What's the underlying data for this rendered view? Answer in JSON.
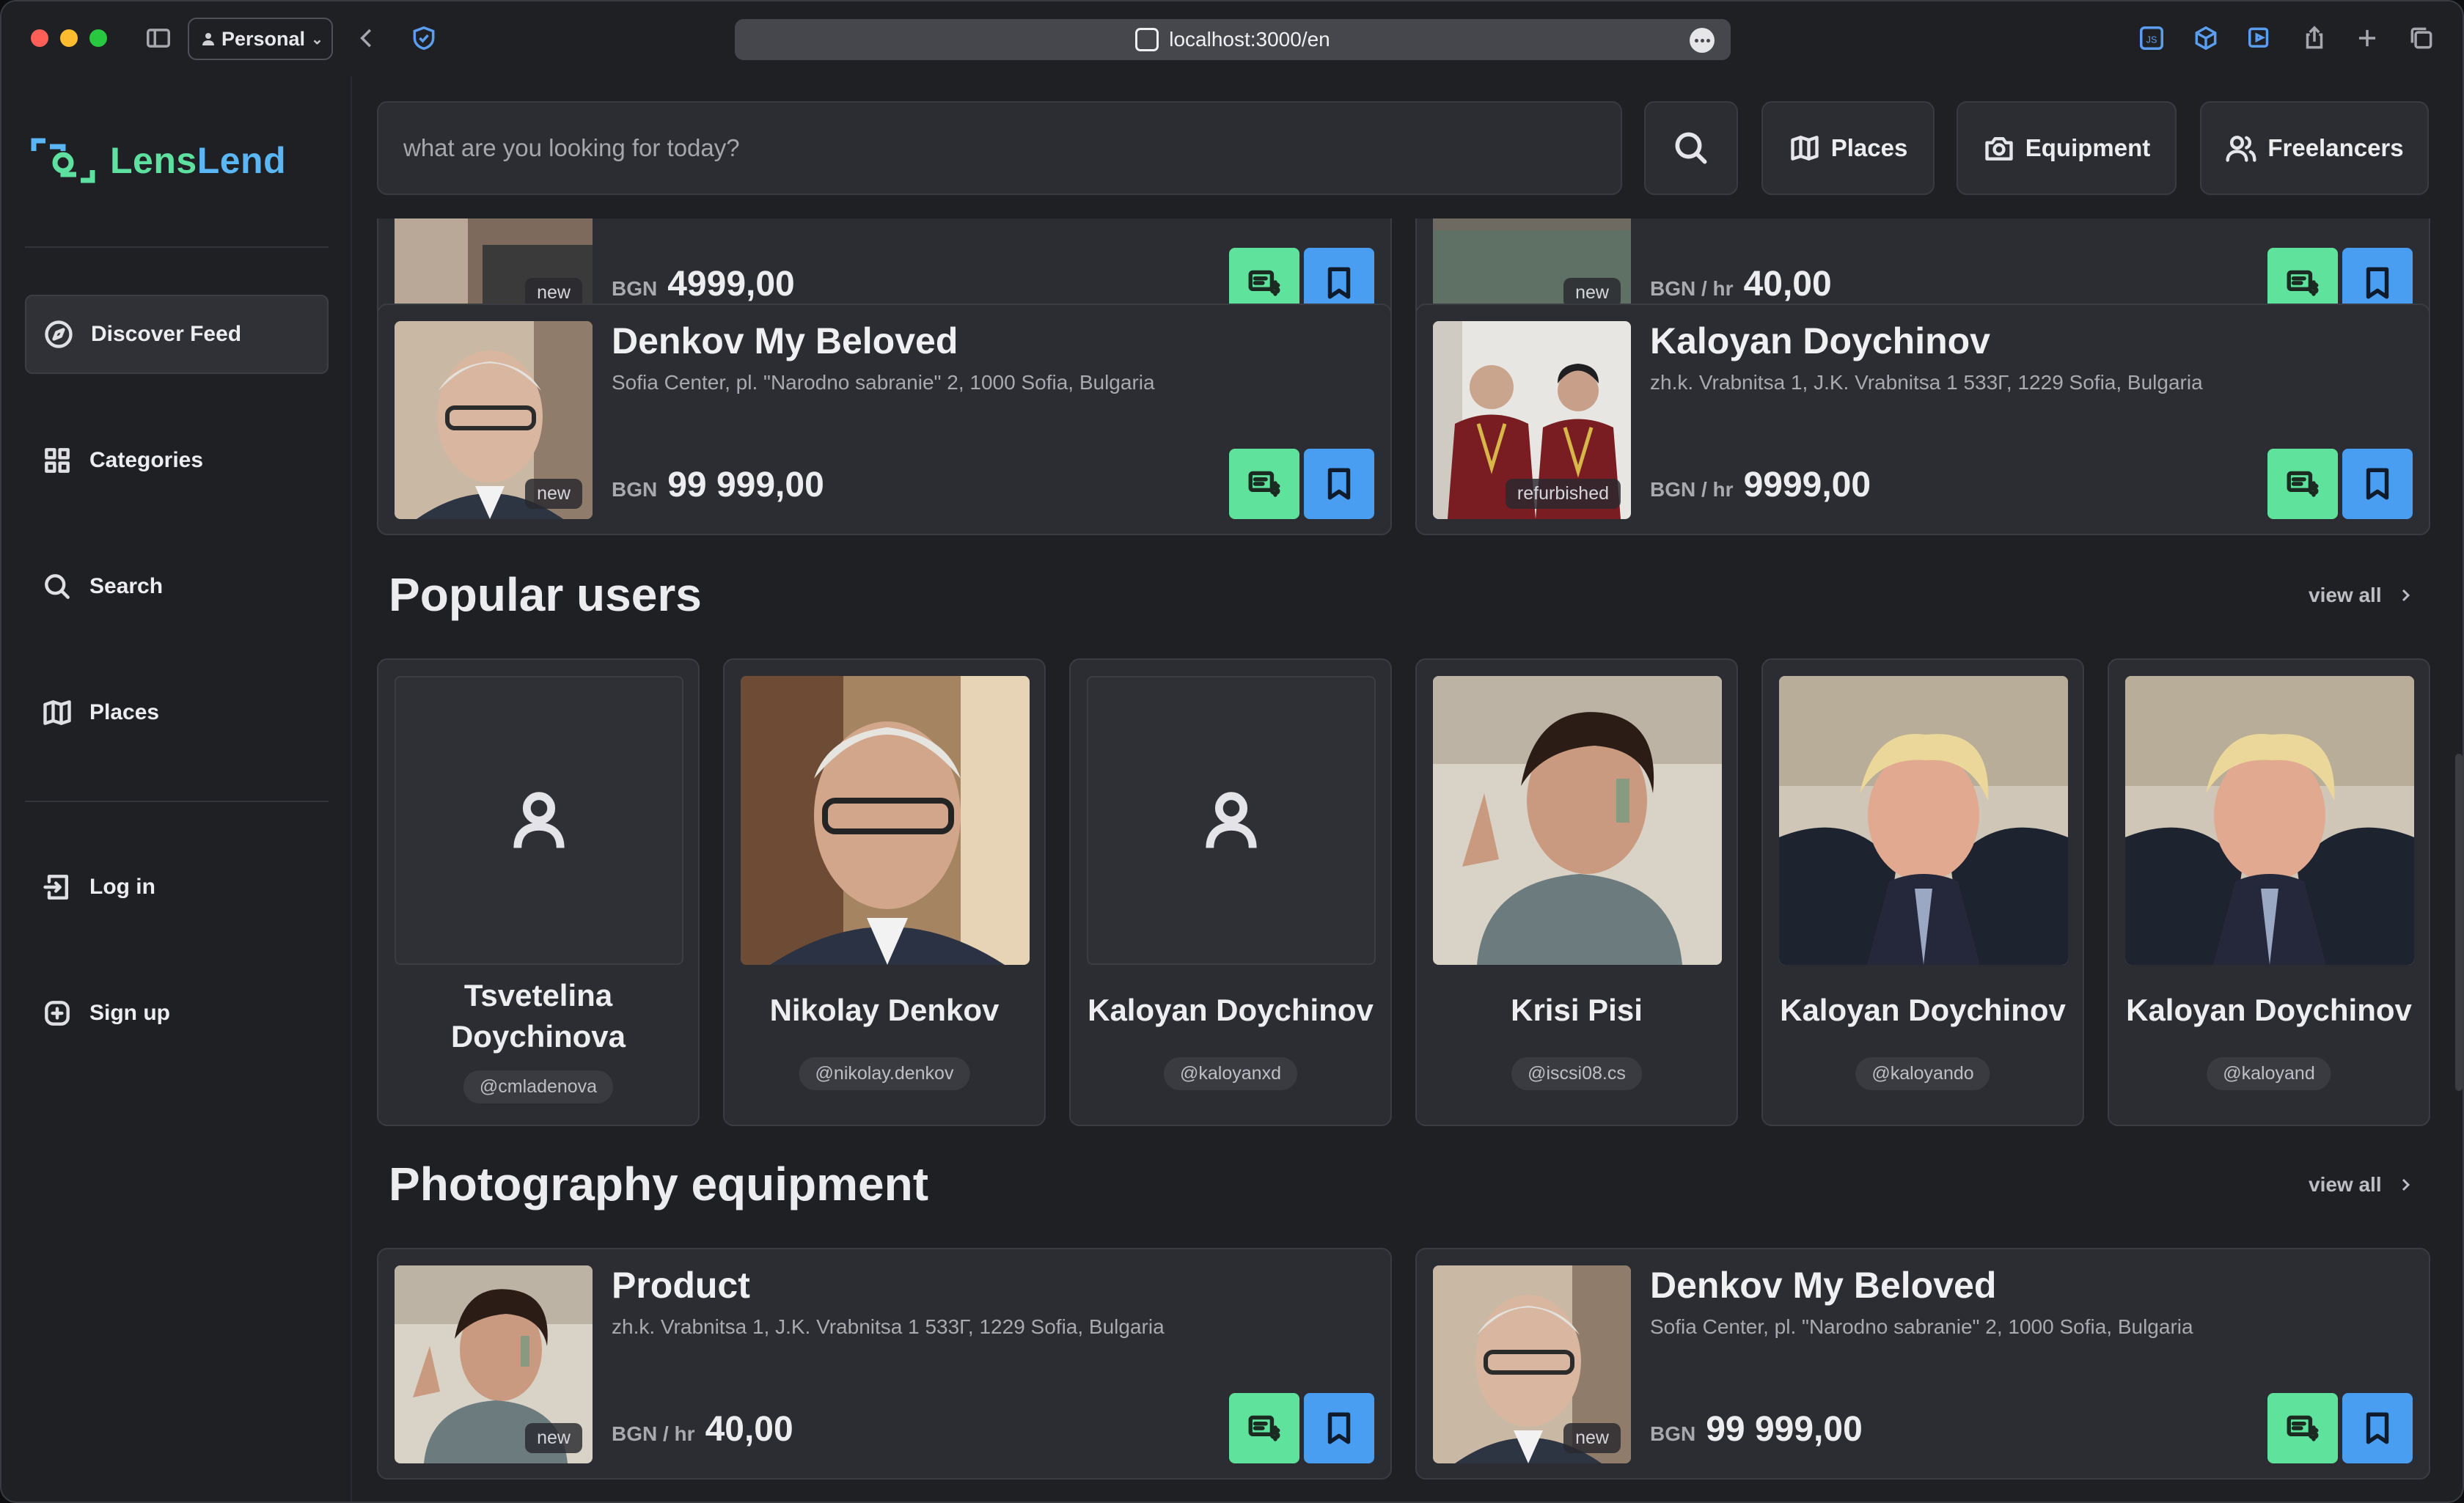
{
  "browser": {
    "profile": "Personal",
    "url": "localhost:3000/en"
  },
  "brand": {
    "name_a": "Lens",
    "name_b": "Lend"
  },
  "sidebar": {
    "items": [
      {
        "label": "Discover Feed",
        "icon": "compass-icon"
      },
      {
        "label": "Categories",
        "icon": "grid-icon"
      },
      {
        "label": "Search",
        "icon": "search-icon"
      },
      {
        "label": "Places",
        "icon": "map-icon"
      },
      {
        "label": "Log in",
        "icon": "login-icon"
      },
      {
        "label": "Sign up",
        "icon": "plus-circle-icon"
      }
    ]
  },
  "topbar": {
    "search_placeholder": "what are you looking for today?",
    "places": "Places",
    "equipment": "Equipment",
    "freelancers": "Freelancers"
  },
  "feed_top": {
    "partial_cards": [
      {
        "condition": "new",
        "currency": "BGN",
        "price": "4999,00"
      },
      {
        "condition": "new",
        "currency": "BGN / hr",
        "price": "40,00"
      }
    ],
    "cards": [
      {
        "title": "Denkov My Beloved",
        "address": "Sofia Center, pl. \"Narodno sabranie\" 2, 1000 Sofia, Bulgaria",
        "condition": "new",
        "currency": "BGN",
        "price": "99 999,00"
      },
      {
        "title": "Kaloyan Doychinov",
        "address": "zh.k. Vrabnitsa 1, J.K. Vrabnitsa 1 533Г, 1229 Sofia, Bulgaria",
        "condition": "refurbished",
        "currency": "BGN / hr",
        "price": "9999,00"
      }
    ]
  },
  "popular_users": {
    "title": "Popular users",
    "view_all": "view all",
    "users": [
      {
        "name": "Tsvetelina Doychinova",
        "handle": "@cmladenova"
      },
      {
        "name": "Nikolay Denkov",
        "handle": "@nikolay.denkov"
      },
      {
        "name": "Kaloyan Doychinov",
        "handle": "@kaloyanxd"
      },
      {
        "name": "Krisi Pisi",
        "handle": "@iscsi08.cs"
      },
      {
        "name": "Kaloyan Doychinov",
        "handle": "@kaloyando"
      },
      {
        "name": "Kaloyan Doychinov",
        "handle": "@kaloyand"
      }
    ]
  },
  "photography_equipment": {
    "title": "Photography equipment",
    "view_all": "view all",
    "cards": [
      {
        "title": "Product",
        "address": "zh.k. Vrabnitsa 1, J.K. Vrabnitsa 1 533Г, 1229 Sofia, Bulgaria",
        "condition": "new",
        "currency": "BGN / hr",
        "price": "40,00"
      },
      {
        "title": "Denkov My Beloved",
        "address": "Sofia Center, pl. \"Narodno sabranie\" 2, 1000 Sofia, Bulgaria",
        "condition": "new",
        "currency": "BGN",
        "price": "99 999,00"
      }
    ]
  },
  "colors": {
    "rent_button": "#5fe29c",
    "save_button": "#4a9ef2",
    "brand_blue": "#5ab6f5",
    "brand_green": "#5ee0a0"
  }
}
